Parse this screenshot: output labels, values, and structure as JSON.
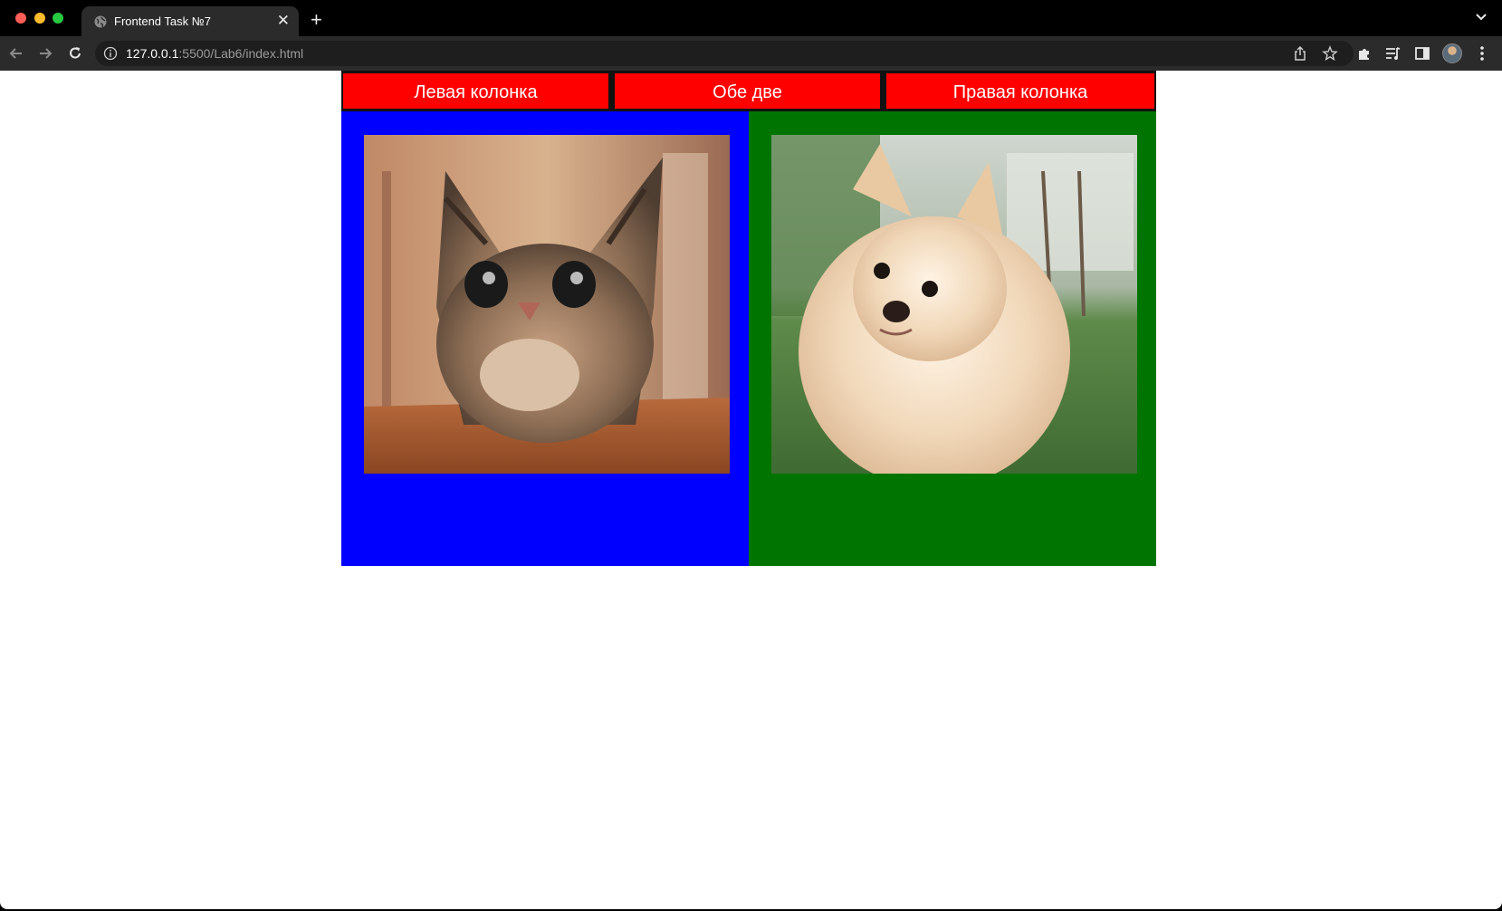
{
  "browser": {
    "tab_title": "Frontend Task №7",
    "tab_icon": "globe-icon",
    "url_host": "127.0.0.1",
    "url_rest": ":5500/Lab6/index.html"
  },
  "page": {
    "buttons": {
      "left": "Левая колонка",
      "both": "Обе две",
      "right": "Правая колонка"
    },
    "colors": {
      "button": "#ff0000",
      "left_column": "#0000ff",
      "right_column": "#007400"
    },
    "images": {
      "left": "cat-photo",
      "right": "pomeranian-dog-photo"
    }
  }
}
